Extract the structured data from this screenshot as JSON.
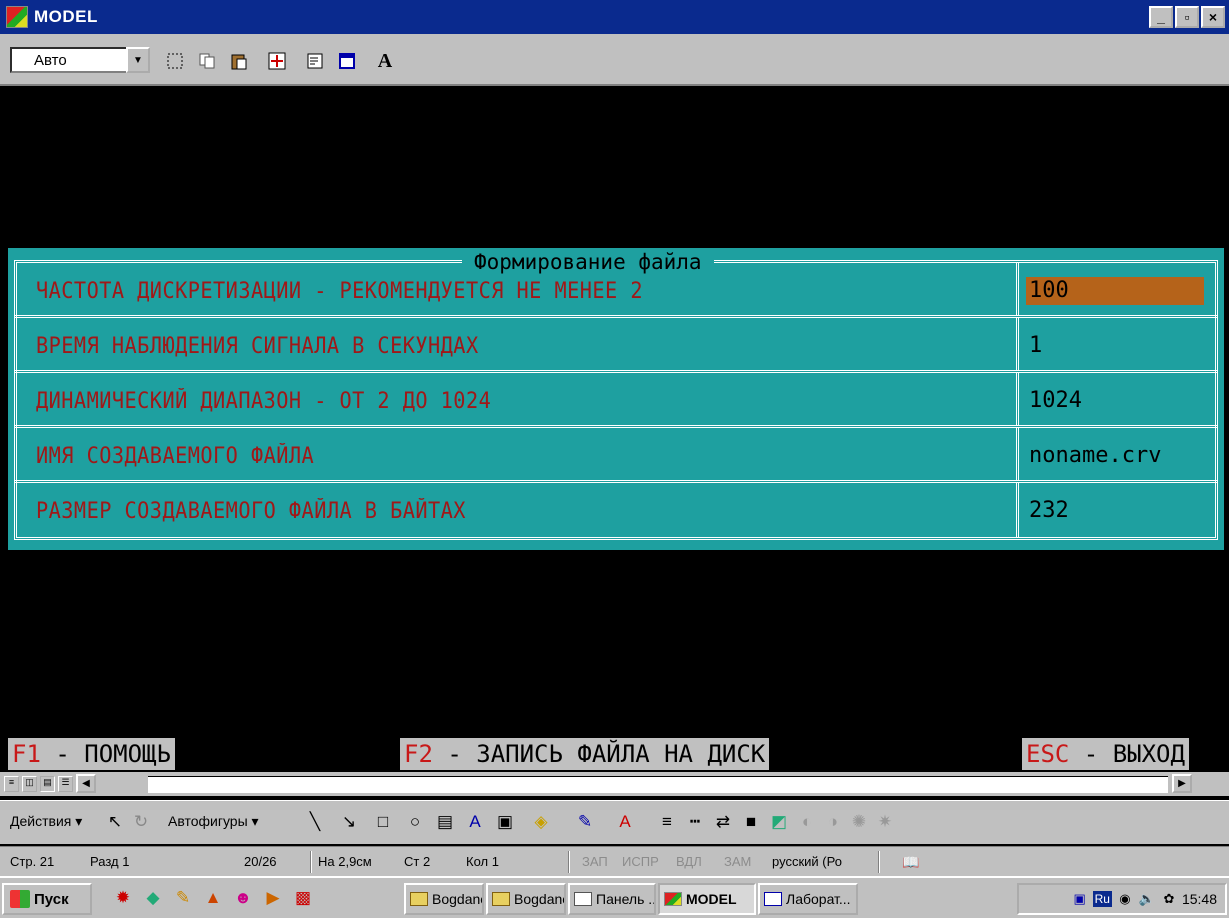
{
  "window": {
    "title": "MODEL",
    "minimize": "_",
    "maximize": "▫",
    "close": "×"
  },
  "dos_toolbar": {
    "font_size_value": "Авто",
    "bold_button": "A"
  },
  "dialog": {
    "title": "Формирование файла",
    "rows": [
      {
        "label": "ЧАСТОТА ДИСКРЕТИЗАЦИИ - РЕКОМЕНДУЕТСЯ НЕ МЕНЕЕ 2",
        "value": "100"
      },
      {
        "label": "ВРЕМЯ НАБЛЮДЕНИЯ СИГНАЛА В СЕКУНДАХ",
        "value": "1"
      },
      {
        "label": "ДИНАМИЧЕСКИЙ ДИАПАЗОН - ОТ 2 ДО 1024",
        "value": "1024"
      },
      {
        "label": "ИМЯ СОЗДАВАЕМОГО ФАЙЛА",
        "value": "noname.crv"
      },
      {
        "label": "РАЗМЕР СОЗДАВАЕМОГО ФАЙЛА В БАЙТАХ",
        "value": "232"
      }
    ]
  },
  "function_keys": [
    {
      "key": "F1",
      "label": " - ПОМОЩЬ"
    },
    {
      "key": "F2",
      "label": " - ЗАПИСЬ ФАЙЛА НА ДИСК"
    },
    {
      "key": "ESC",
      "label": " - ВЫХОД"
    }
  ],
  "drawing_toolbar": {
    "actions": "Действия ▾",
    "autoshapes": "Автофигуры ▾"
  },
  "status_bar": {
    "page": "Стр. 21",
    "section": "Разд 1",
    "page_of": "20/26",
    "at": "На 2,9см",
    "line": "Ст 2",
    "col": "Кол 1",
    "rec": "ЗАП",
    "trk": "ИСПР",
    "ext": "ВДЛ",
    "ovr": "ЗАМ",
    "language": "русский (Ро"
  },
  "taskbar": {
    "start": "Пуск",
    "tasks": [
      "Bogdanov",
      "Bogdanov",
      "Панель ...",
      "MODEL",
      "Лаборат..."
    ],
    "tray_lang": "Ru",
    "clock": "15:48"
  }
}
